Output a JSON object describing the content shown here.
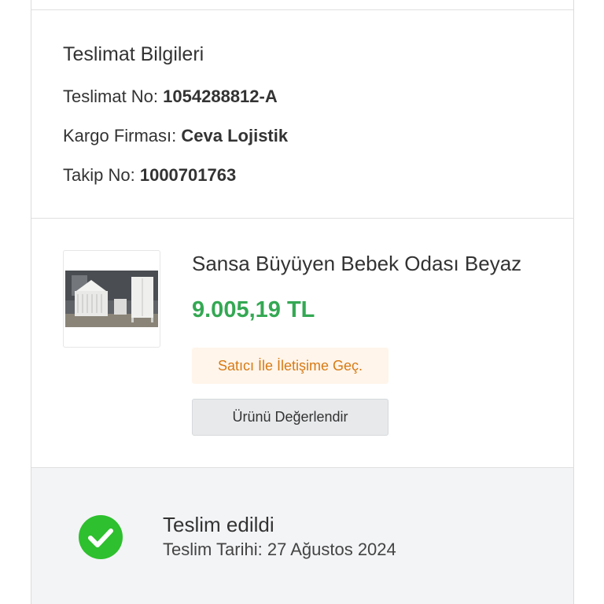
{
  "delivery_info": {
    "title": "Teslimat Bilgileri",
    "delivery_no_label": "Teslimat No:",
    "delivery_no_value": "1054288812-A",
    "carrier_label": "Kargo Firması:",
    "carrier_value": "Ceva Lojistik",
    "tracking_label": "Takip No:",
    "tracking_value": "1000701763"
  },
  "product": {
    "name": "Sansa Büyüyen Bebek Odası Beyaz",
    "price": "9.005,19 TL",
    "image_icon": "baby-room-furniture-image",
    "contact_seller_label": "Satıcı İle İletişime Geç.",
    "review_label": "Ürünü Değerlendir"
  },
  "status": {
    "icon": "check-circle-icon",
    "title": "Teslim edildi",
    "date_text": "Teslim Tarihi: 27 Ağustos 2024"
  },
  "colors": {
    "price_green": "#34a853",
    "status_green": "#2ec02e",
    "contact_orange": "#d77a14",
    "contact_bg": "#fff5ea",
    "review_bg": "#e7e9eb",
    "status_bg": "#f3f4f6"
  }
}
